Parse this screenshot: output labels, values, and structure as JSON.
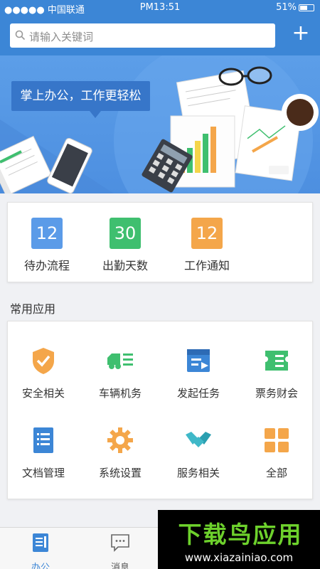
{
  "status_bar": {
    "carrier": "●●●●● 中国联通",
    "time": "PM13:51",
    "battery": "51%"
  },
  "search": {
    "placeholder": "请输入关键词",
    "add_label": "+"
  },
  "banner": {
    "slogan": "掌上办公，工作更轻松"
  },
  "stats": [
    {
      "value": "12",
      "label": "待办流程",
      "color": "#5b9be8"
    },
    {
      "value": "30",
      "label": "出勤天数",
      "color": "#3fbf6f"
    },
    {
      "value": "12",
      "label": "工作通知",
      "color": "#f4a64a"
    }
  ],
  "apps_section": {
    "title": "常用应用",
    "items": [
      {
        "label": "安全相关",
        "icon": "shield-check-icon"
      },
      {
        "label": "车辆机务",
        "icon": "truck-icon"
      },
      {
        "label": "发起任务",
        "icon": "task-icon"
      },
      {
        "label": "票务财会",
        "icon": "ticket-icon"
      },
      {
        "label": "文档管理",
        "icon": "document-icon"
      },
      {
        "label": "系统设置",
        "icon": "gear-icon"
      },
      {
        "label": "服务相关",
        "icon": "handshake-icon"
      },
      {
        "label": "全部",
        "icon": "grid-icon"
      }
    ]
  },
  "tabs": [
    {
      "label": "办公",
      "active": true
    },
    {
      "label": "消息",
      "active": false
    }
  ],
  "watermark": {
    "title": "下载鸟应用",
    "url": "www.xiazainiao.com"
  }
}
